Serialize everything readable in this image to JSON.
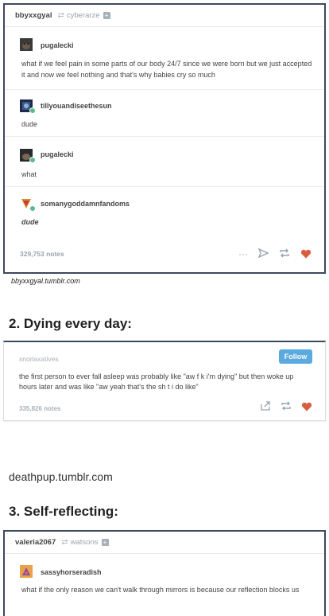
{
  "card1": {
    "reblogger": "bbyxxgyal",
    "via_user": "cyberarze",
    "posts": [
      {
        "user": "pugalecki",
        "text": "what if we feel pain in some parts of our body 24/7 since we were born but we just accepted it and now we feel nothing and that's why babies cry so much"
      },
      {
        "user": "tillyouandiseethesun",
        "text": "dude"
      },
      {
        "user": "pugalecki",
        "text": "what"
      },
      {
        "user": "somanygoddamnfandoms",
        "text": "dude"
      }
    ],
    "notes": "329,753 notes",
    "more_icon": "···",
    "share_icon": "paper-plane",
    "reblog_icon": "reblog",
    "like_icon": "heart",
    "accent_like": "#d95e40"
  },
  "caption1": "bbyxxgyal.tumblr.com",
  "heading2": "2. Dying every day:",
  "card2": {
    "user": "snorlaxatives",
    "follow_label": "Follow",
    "text": "the first person to ever fall asleep was probably like \"aw f     k i'm dying\" but then woke up hours later and was like \"aw yeah that's the sh t i do like\"",
    "notes": "335,826 notes",
    "follow_color": "#5aa9df"
  },
  "url2": "deathpup.tumblr.com",
  "heading3": "3. Self-reflecting:",
  "card3": {
    "reblogger": "valeria2067",
    "via_user": "watsons",
    "user": "sassyhorseradish",
    "text": "what if the only reason we can't walk through mirrors is because our reflection blocks us"
  }
}
